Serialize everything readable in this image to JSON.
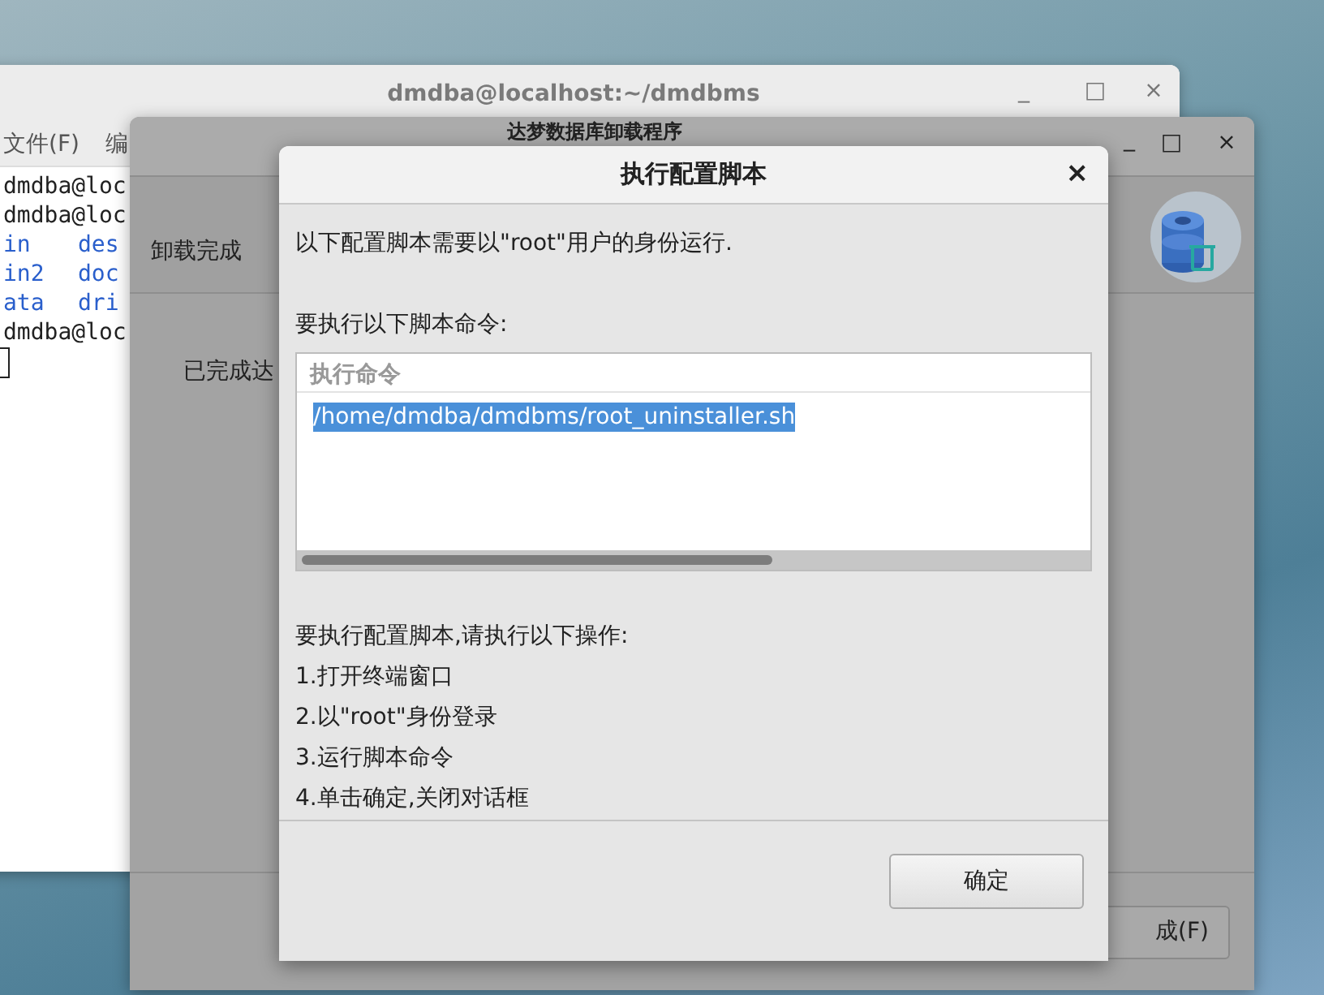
{
  "terminal": {
    "title": "dmdba@localhost:~/dmdbms",
    "menu": [
      "文件(F)",
      "编"
    ],
    "lines": [
      {
        "kind": "prompt",
        "cells": [
          "dmdba@loc"
        ]
      },
      {
        "kind": "prompt",
        "cells": [
          "dmdba@loc"
        ]
      },
      {
        "kind": "listing",
        "cells": [
          "in",
          "des"
        ]
      },
      {
        "kind": "listing",
        "cells": [
          "in2",
          "doc"
        ]
      },
      {
        "kind": "listing",
        "cells": [
          "ata",
          "dri"
        ]
      },
      {
        "kind": "prompt",
        "cells": [
          "dmdba@loc"
        ]
      },
      {
        "kind": "cursor"
      }
    ],
    "controls": [
      "_",
      "□",
      "×"
    ]
  },
  "installer": {
    "title": "达梦数据库卸载程序",
    "controls": [
      "_",
      "□",
      "×"
    ],
    "header": "卸载完成",
    "body": "已完成达",
    "finish_button": "成(F)"
  },
  "dialog": {
    "title": "执行配置脚本",
    "close": "×",
    "intro": "以下配置脚本需要以\"root\"用户的身份运行.",
    "commands_label": "要执行以下脚本命令:",
    "table": {
      "column": "执行命令",
      "rows": [
        {
          "text": "/home/dmdba/dmdbms/root_uninstaller.sh",
          "selected": true
        }
      ]
    },
    "steps_heading": "要执行配置脚本,请执行以下操作:",
    "steps": [
      "1.打开终端窗口",
      "2.以\"root\"身份登录",
      "3.运行脚本命令",
      "4.单击确定,关闭对话框"
    ],
    "ok_button": "确定"
  }
}
